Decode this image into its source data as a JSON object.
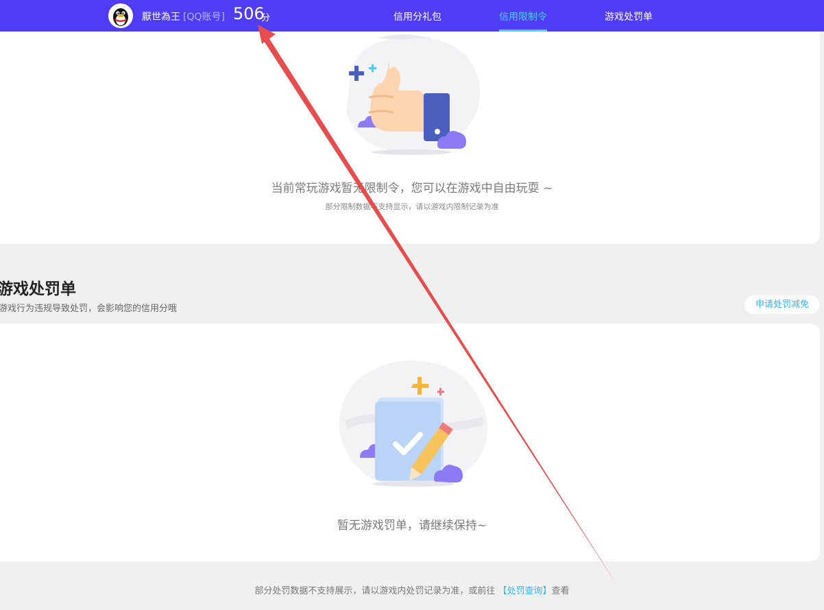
{
  "header": {
    "nickname": "厭世為王",
    "account_type": "[QQ账号]",
    "score": "506",
    "score_unit": "分",
    "nav": [
      {
        "label": "信用分礼包"
      },
      {
        "label": "信用限制令",
        "active": true
      },
      {
        "label": "游戏处罚单"
      }
    ]
  },
  "restriction": {
    "empty_title": "当前常玩游戏暂无限制令，您可以在游戏中自由玩耍 ~",
    "empty_sub": "部分限制数据不支持显示，请以游戏内限制记录为准"
  },
  "penalty": {
    "title": "游戏处罚单",
    "subtitle": "游戏行为违规导致处罚，会影响您的信用分哦",
    "appeal_button": "申请处罚减免",
    "empty_title": "暂无游戏罚单，请继续保持~"
  },
  "footer": {
    "note_prefix": "部分处罚数据不支持展示，请以游戏内处罚记录为准，或前往 ",
    "link": "【处罚查询】",
    "note_suffix": "查看"
  },
  "colors": {
    "header_bg": "#4f3df5",
    "nav_active": "#45d3ff",
    "link": "#35b4f0",
    "annotation_arrow": "#e84d4d"
  },
  "icons": [
    "qq-penguin-avatar-icon",
    "thumbs-up-illustration",
    "checklist-pencil-illustration"
  ]
}
